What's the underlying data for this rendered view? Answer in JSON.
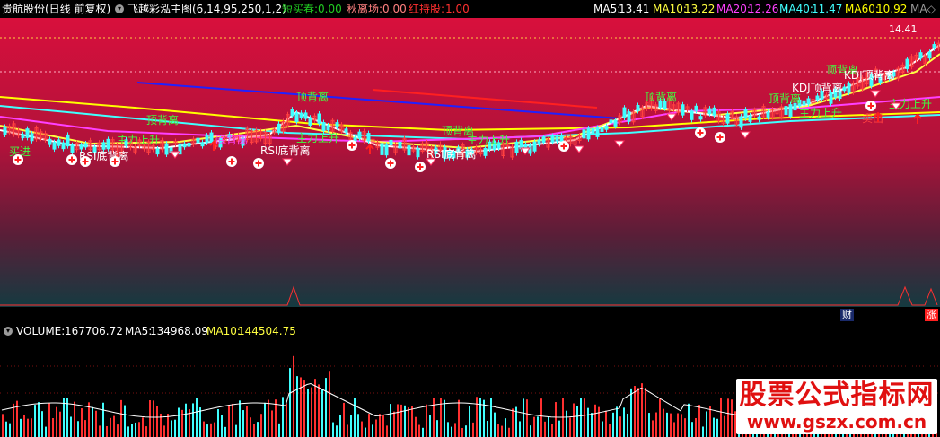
{
  "header": {
    "stock": "贵航股份(日线 前复权)",
    "indicator": "飞越彩泓主图(6,14,95,250,1,2)",
    "readouts": [
      {
        "label": "短买春:",
        "value": "0.00",
        "color": "#22cc22"
      },
      {
        "label": "秋离场:",
        "value": "0.00",
        "color": "#ff8080"
      },
      {
        "label": "红持股:",
        "value": "1.00",
        "color": "#ff3030"
      }
    ],
    "ma": [
      {
        "label": "MA5:",
        "value": "13.41",
        "color": "#ffffff"
      },
      {
        "label": "MA10:",
        "value": "13.22",
        "color": "#ffff40"
      },
      {
        "label": "MA20:",
        "value": "12.26",
        "color": "#ff40ff"
      },
      {
        "label": "MA40:",
        "value": "11.47",
        "color": "#40ffff"
      },
      {
        "label": "MA60:",
        "value": "10.92",
        "color": "#ffff00"
      }
    ],
    "ma_more": "MA◇"
  },
  "volume_header": {
    "label": "VOLUME:",
    "value": "167706.72",
    "ma5_label": "MA5:",
    "ma5_value": "134968.09",
    "ma10_label": "MA10:",
    "ma10_value": "144504.75"
  },
  "tags": {
    "cai": "财",
    "zhang": "涨"
  },
  "watermark": {
    "line1": "股票公式指标网",
    "line2": "www.gszx.com.cn"
  },
  "colors": {
    "bg_top": "#d0103c",
    "bg_bottom": "#153a40",
    "ma5": "#ffffff",
    "ma10": "#ffff40",
    "ma20": "#ff40ff",
    "ma40": "#40ffff",
    "ma60": "#ffff00",
    "vol_up": "#ff3030",
    "vol_down": "#40ffff"
  },
  "chart_data": {
    "type": "line",
    "price_label": "14.41",
    "signals": [
      {
        "text": "顶背离",
        "color": "#40ff40"
      },
      {
        "text": "顶背离",
        "color": "#40ff40"
      },
      {
        "text": "顶背离",
        "color": "#40ff40"
      },
      {
        "text": "顶背离",
        "color": "#40ff40"
      },
      {
        "text": "顶背离",
        "color": "#40ff40"
      },
      {
        "text": "顶背离",
        "color": "#40ff40"
      },
      {
        "text": "RSI底背离",
        "color": "#ffffff"
      },
      {
        "text": "RSI底背离",
        "color": "#ffffff"
      },
      {
        "text": "RSI底背离",
        "color": "#ffffff"
      },
      {
        "text": "KDJ顶背离",
        "color": "#ffffff"
      },
      {
        "text": "KDJ顶背离",
        "color": "#ffffff"
      },
      {
        "text": "主力上升",
        "color": "#40ff40"
      },
      {
        "text": "主力上升",
        "color": "#40ff40"
      },
      {
        "text": "主力上升",
        "color": "#40ff40"
      },
      {
        "text": "主力上升",
        "color": "#40ff40"
      },
      {
        "text": "主力上升",
        "color": "#40ff40"
      },
      {
        "text": "卖出",
        "color": "#ff4040"
      },
      {
        "text": "买进",
        "color": "#40ff40"
      },
      {
        "text": "底背离",
        "color": "#ff40ff"
      }
    ]
  }
}
